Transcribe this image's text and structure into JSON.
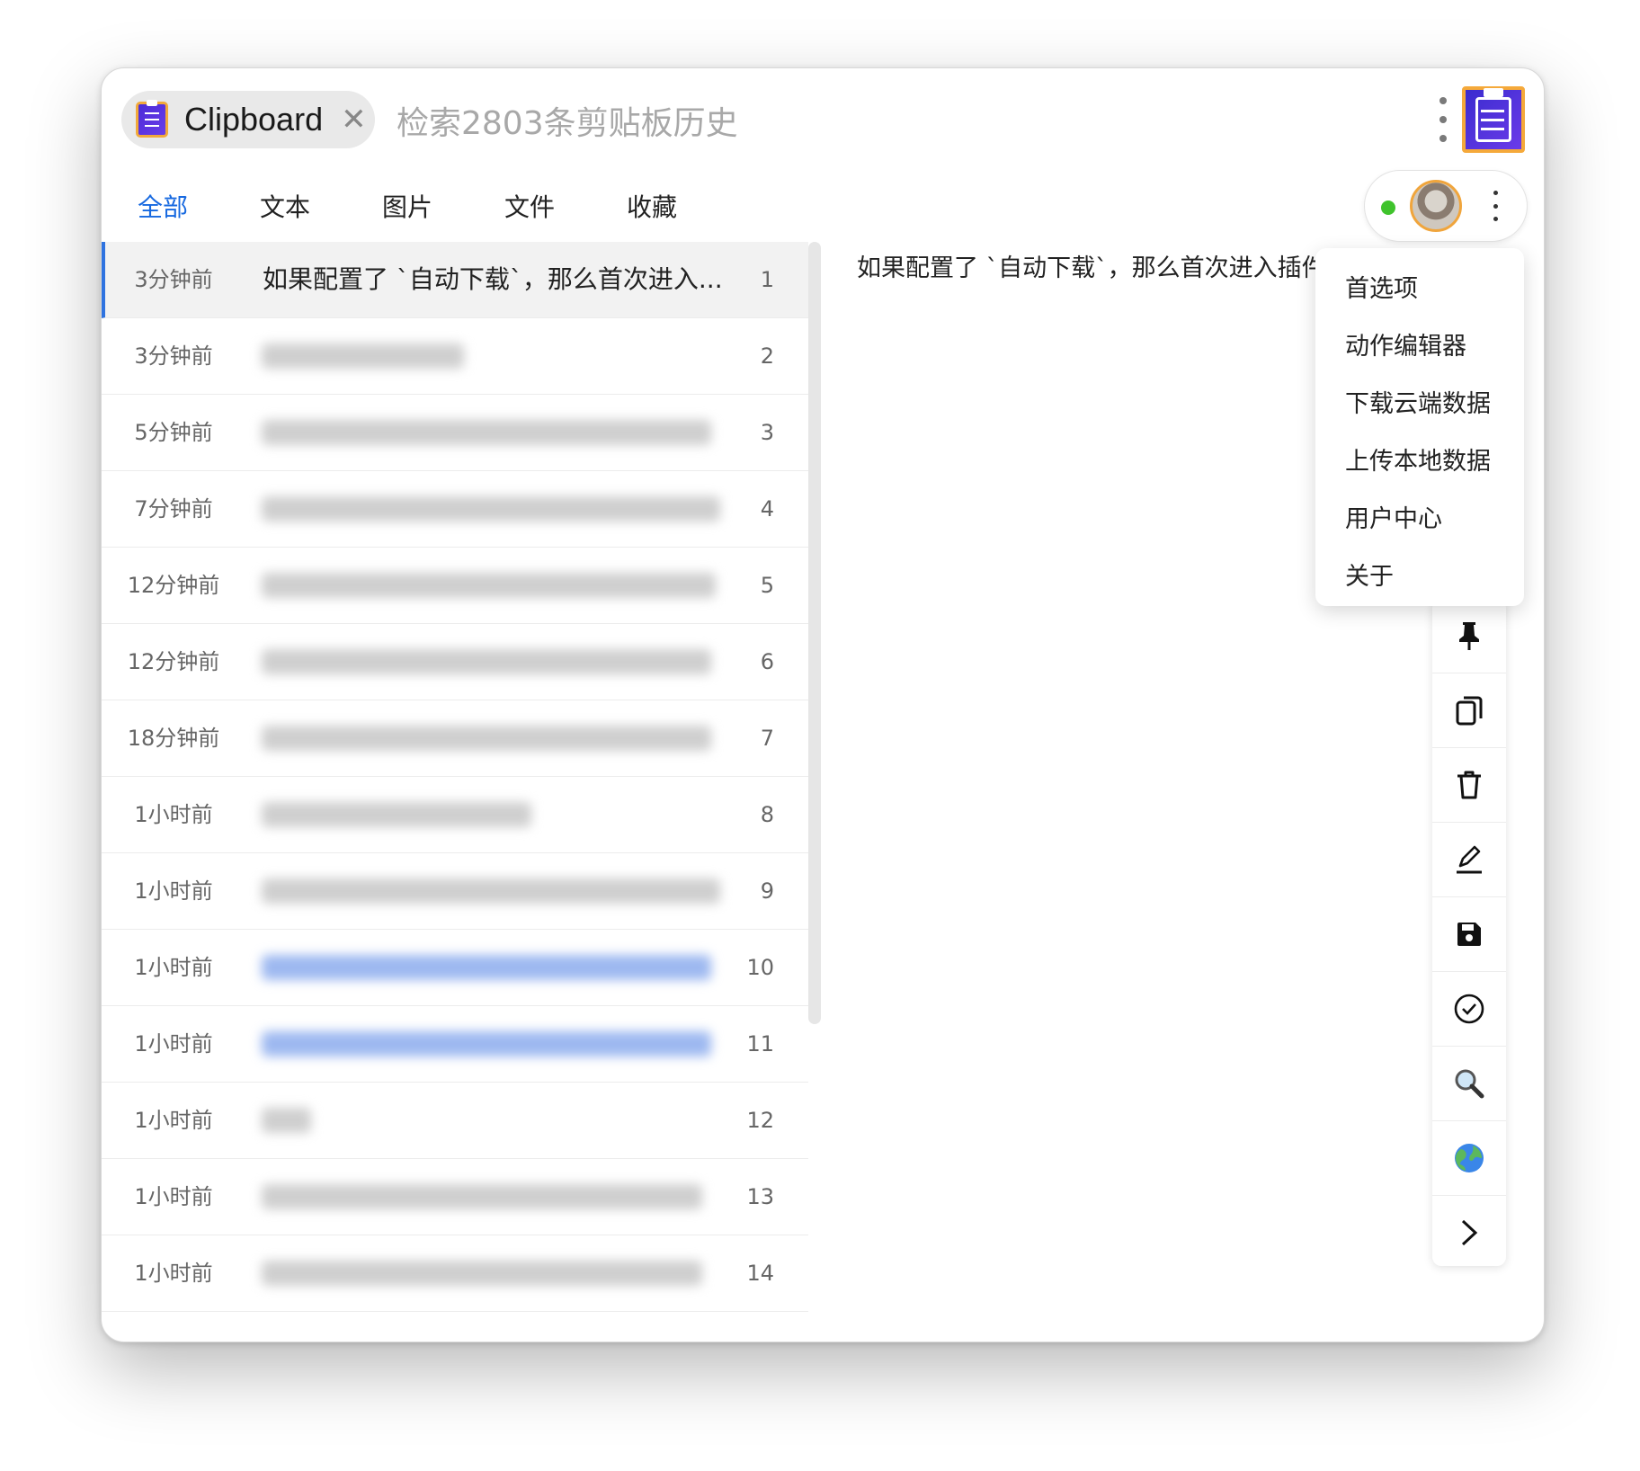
{
  "window": {
    "tab_title": "Clipboard",
    "close_glyph": "✕",
    "search_placeholder": "检索2803条剪贴板历史"
  },
  "filters": [
    "全部",
    "文本",
    "图片",
    "文件",
    "收藏"
  ],
  "active_filter": "全部",
  "colors": {
    "accent": "#1769e0",
    "online": "#3fc32c",
    "icon_border": "#f5a93a",
    "icon_fill": "#4b2bd8"
  },
  "history": [
    {
      "time": "3分钟前",
      "text": "如果配置了 `自动下载`，那么首次进入...",
      "index": "1",
      "blurred": false
    },
    {
      "time": "3分钟前",
      "index": "2",
      "blurred": true
    },
    {
      "time": "5分钟前",
      "index": "3",
      "blurred": true
    },
    {
      "time": "7分钟前",
      "index": "4",
      "blurred": true
    },
    {
      "time": "12分钟前",
      "index": "5",
      "blurred": true
    },
    {
      "time": "12分钟前",
      "index": "6",
      "blurred": true
    },
    {
      "time": "18分钟前",
      "index": "7",
      "blurred": true
    },
    {
      "time": "1小时前",
      "index": "8",
      "blurred": true
    },
    {
      "time": "1小时前",
      "index": "9",
      "blurred": true
    },
    {
      "time": "1小时前",
      "index": "10",
      "blurred": true
    },
    {
      "time": "1小时前",
      "index": "11",
      "blurred": true
    },
    {
      "time": "1小时前",
      "index": "12",
      "blurred": true
    },
    {
      "time": "1小时前",
      "index": "13",
      "blurred": true
    },
    {
      "time": "1小时前",
      "index": "14",
      "blurred": true
    }
  ],
  "preview_text": "如果配置了 `自动下载`，那么首次进入插件时会自动",
  "menu_items": [
    "首选项",
    "动作编辑器",
    "下载云端数据",
    "上传本地数据",
    "用户中心",
    "关于"
  ],
  "toolbar_icons": [
    "pin-icon",
    "copy-icon",
    "trash-icon",
    "edit-icon",
    "save-icon",
    "check-circle-icon",
    "search-icon",
    "globe-icon",
    "chevron-right-icon"
  ]
}
